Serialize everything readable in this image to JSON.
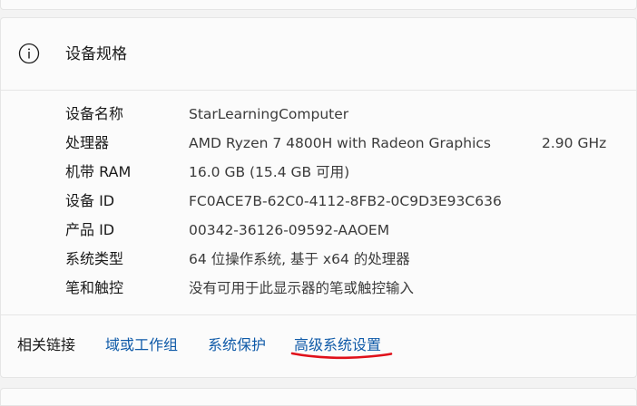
{
  "header": {
    "title": "设备规格",
    "icon": "info-icon"
  },
  "specs": [
    {
      "label": "设备名称",
      "value": "StarLearningComputer",
      "extra": ""
    },
    {
      "label": "处理器",
      "value": "AMD Ryzen 7 4800H with Radeon Graphics",
      "extra": "2.90 GHz"
    },
    {
      "label": "机带 RAM",
      "value": "16.0 GB (15.4 GB 可用)",
      "extra": ""
    },
    {
      "label": "设备 ID",
      "value": "FC0ACE7B-62C0-4112-8FB2-0C9D3E93C636",
      "extra": ""
    },
    {
      "label": "产品 ID",
      "value": "00342-36126-09592-AAOEM",
      "extra": ""
    },
    {
      "label": "系统类型",
      "value": "64 位操作系统, 基于 x64 的处理器",
      "extra": ""
    },
    {
      "label": "笔和触控",
      "value": "没有可用于此显示器的笔或触控输入",
      "extra": ""
    }
  ],
  "related_links": {
    "label": "相关链接",
    "links": [
      "域或工作组",
      "系统保护",
      "高级系统设置"
    ]
  },
  "colors": {
    "link": "#0f5aa8",
    "annotation": "#e0101a",
    "card_bg": "#fbfbfb",
    "page_bg": "#f3f3f3"
  }
}
